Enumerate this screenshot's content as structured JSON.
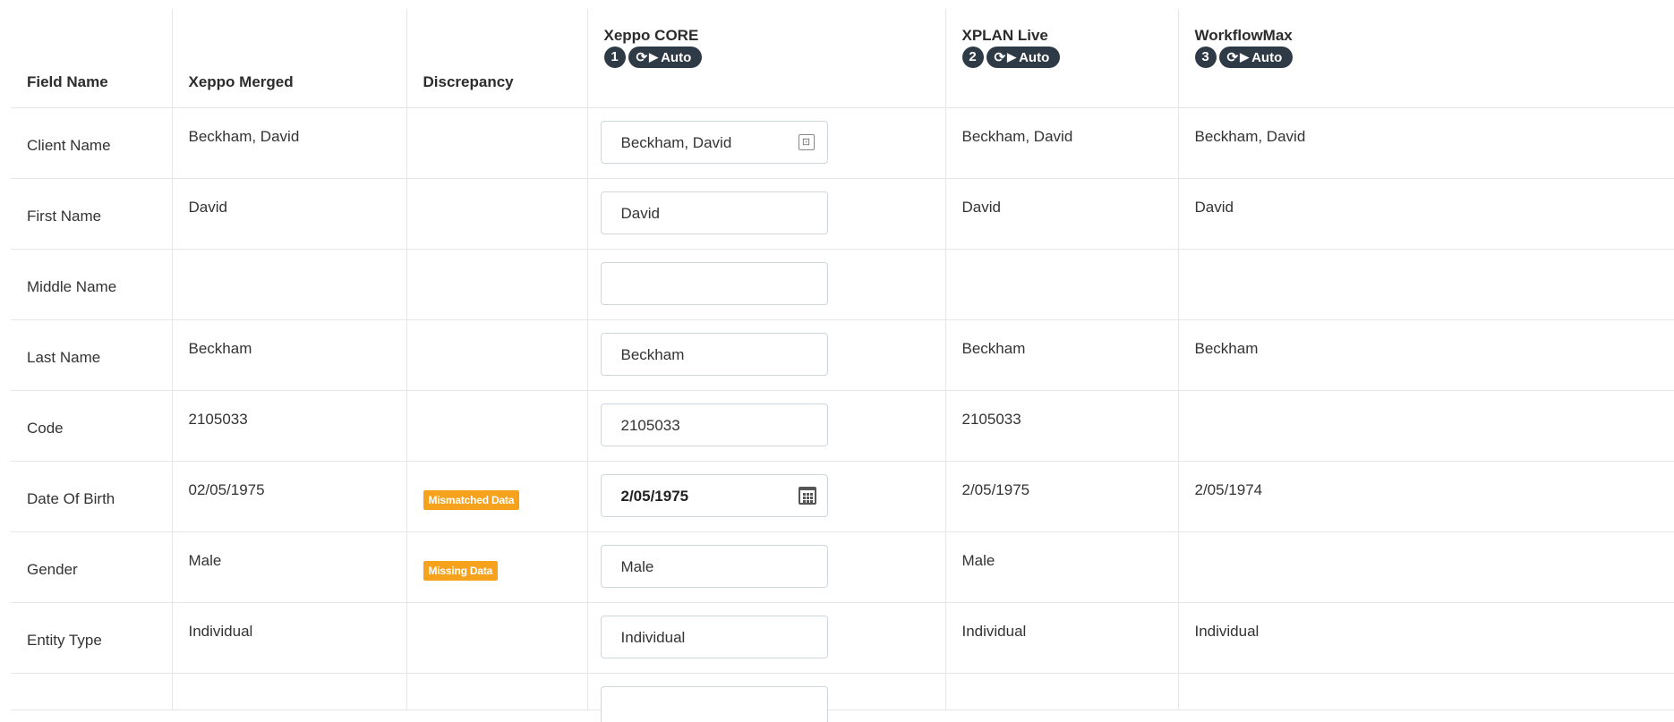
{
  "headers": {
    "field_name": "Field Name",
    "merged": "Xeppo Merged",
    "discrepancy": "Discrepancy",
    "sources": [
      {
        "name": "Xeppo CORE",
        "num": "1",
        "auto": "Auto"
      },
      {
        "name": "XPLAN Live",
        "num": "2",
        "auto": "Auto"
      },
      {
        "name": "WorkflowMax",
        "num": "3",
        "auto": "Auto"
      }
    ]
  },
  "rows": [
    {
      "field": "Client Name",
      "merged": "Beckham, David",
      "discrepancy": "",
      "core": "Beckham, David",
      "xplan": "Beckham, David",
      "wfm": "Beckham, David"
    },
    {
      "field": "First Name",
      "merged": "David",
      "discrepancy": "",
      "core": "David",
      "xplan": "David",
      "wfm": "David"
    },
    {
      "field": "Middle Name",
      "merged": "",
      "discrepancy": "",
      "core": "",
      "xplan": "",
      "wfm": ""
    },
    {
      "field": "Last Name",
      "merged": "Beckham",
      "discrepancy": "",
      "core": "Beckham",
      "xplan": "Beckham",
      "wfm": "Beckham"
    },
    {
      "field": "Code",
      "merged": "2105033",
      "discrepancy": "",
      "core": "2105033",
      "xplan": "2105033",
      "wfm": ""
    },
    {
      "field": "Date Of Birth",
      "merged": "02/05/1975",
      "discrepancy": "Mismatched Data",
      "core": "2/05/1975",
      "xplan": "2/05/1975",
      "wfm": "2/05/1974"
    },
    {
      "field": "Gender",
      "merged": "Male",
      "discrepancy": "Missing Data",
      "core": "Male",
      "xplan": "Male",
      "wfm": ""
    },
    {
      "field": "Entity Type",
      "merged": "Individual",
      "discrepancy": "",
      "core": "Individual",
      "xplan": "Individual",
      "wfm": "Individual"
    }
  ],
  "icons": {
    "contact_card": "contact-card-icon",
    "calendar": "calendar-icon",
    "sync": "sync-icon",
    "play": "play-icon"
  },
  "colors": {
    "badge_bg": "#2e3a46",
    "flag_bg": "#f7a21c",
    "border": "#e6e6e6"
  }
}
